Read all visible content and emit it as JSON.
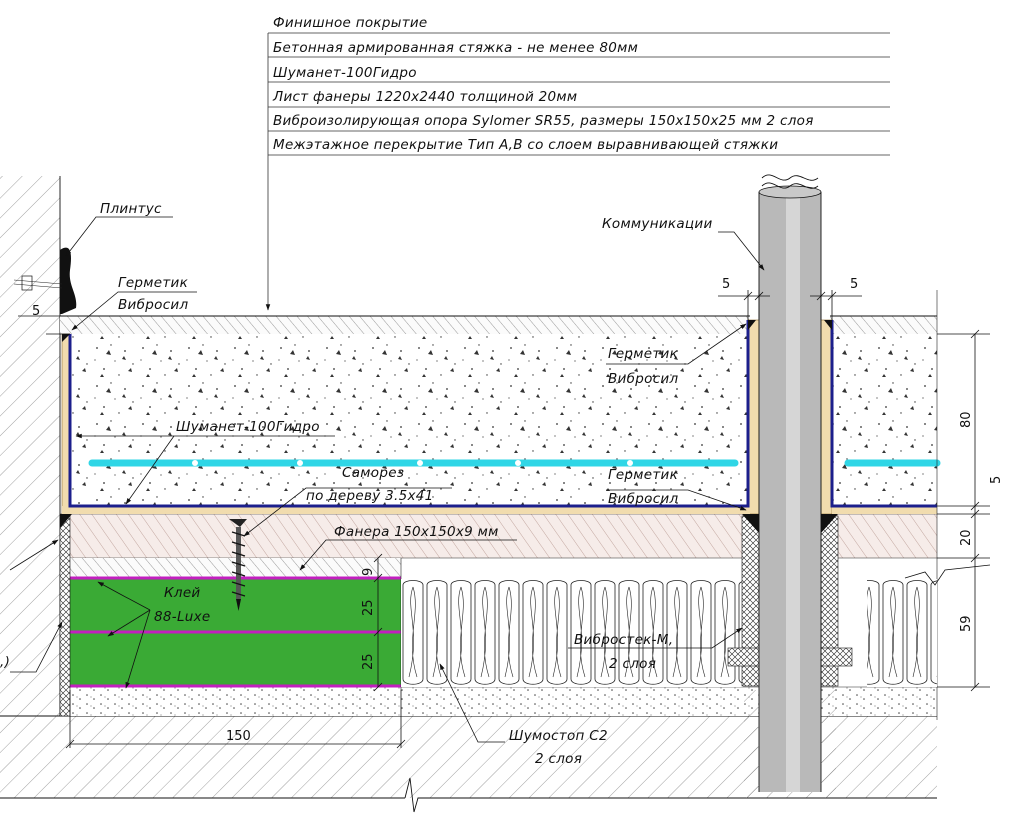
{
  "legend": {
    "items": [
      "Финишное покрытие",
      "Бетонная армированная стяжка - не менее 80мм",
      "Шуманет-100Гидро",
      "Лист фанеры 1220х2440 толщиной 20мм",
      "Виброизолирующая опора Sylomer SR55, размеры 150х150х25 мм 2 слоя",
      "Межэтажное перекрытие Тип А,В со слоем выравнивающей стяжки"
    ]
  },
  "callouts": {
    "plintus": "Плинтус",
    "germetik_left": "Герметик",
    "vibrosil_left": "Вибросил",
    "kommunikacii": "Коммуникации",
    "germetik_right_top": "Герметик",
    "vibrosil_right_top": "Вибросил",
    "shumanet": "Шуманет-100Гидро",
    "samorez_1": "Саморез",
    "samorez_2": "по дереву 3.5х41",
    "germetik_right_bottom": "Герметик",
    "vibrosil_right_bottom": "Вибросил",
    "fanera": "Фанера 150х150х9 мм",
    "klei_1": "Клей",
    "klei_2": "88-Luxe",
    "vibrostek_1": "Вибростек-М,",
    "vibrostek_2": "2 слоя",
    "shumostop_1": "Шумостоп С2",
    "shumostop_2": "2 слоя",
    "left_cut": ",)"
  },
  "dimensions": {
    "gap_left": "5",
    "gap_pipe_left": "5",
    "gap_pipe_right": "5",
    "screed": "80",
    "shumanet_gap": "5",
    "plywood": "20",
    "support": "59",
    "pad_upper": "9",
    "pad_mid": "25",
    "pad_low": "25",
    "pad_width": "150"
  },
  "colors": {
    "pad_green": "#3aaa35",
    "glue_magenta": "#c21fbf",
    "membrane_blue": "#1c1f8c",
    "pipe_cyan": "#2fd6e6",
    "sealant_tan": "#f1dcae",
    "plywood_pink": "#f4e6e3"
  }
}
